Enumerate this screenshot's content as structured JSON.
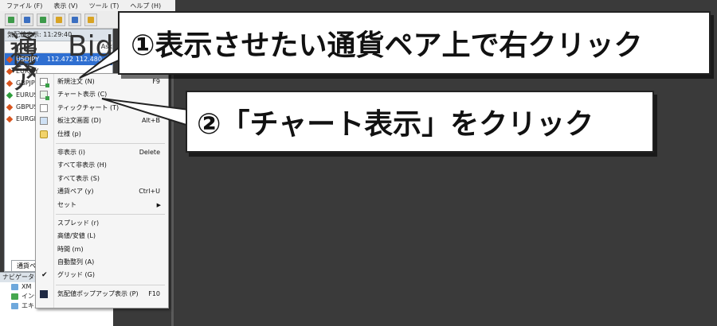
{
  "menubar": {
    "items": [
      "ファイル (F)",
      "表示 (V)",
      "ツール (T)",
      "ヘルプ (H)"
    ]
  },
  "market_watch": {
    "title": "気配値表示: 11:29:40",
    "columns": [
      "通貨ペア",
      "Bid",
      "Ask"
    ],
    "rows": [
      {
        "symbol": "USDJPY",
        "bid": "112.472",
        "ask": "112.480",
        "color": "red"
      },
      {
        "symbol": "EURJPY",
        "bid": "",
        "ask": "",
        "color": "red"
      },
      {
        "symbol": "GBPJPY",
        "bid": "",
        "ask": "",
        "color": "red"
      },
      {
        "symbol": "EURUSD",
        "bid": "",
        "ask": "",
        "color": "green"
      },
      {
        "symbol": "GBPUSD",
        "bid": "",
        "ask": "",
        "color": "red"
      },
      {
        "symbol": "EURGBP",
        "bid": "",
        "ask": "",
        "color": "red"
      }
    ],
    "tab": "通貨ペア"
  },
  "navigator": {
    "title": "ナビゲーター",
    "items": [
      "XM",
      "インディケータ",
      "エキスパートアドバイザ"
    ]
  },
  "context_menu": {
    "items": [
      {
        "label": "新規注文 (N)",
        "shortcut": "F9"
      },
      {
        "label": "チャート表示 (C)",
        "shortcut": ""
      },
      {
        "label": "ティックチャート (T)",
        "shortcut": ""
      },
      {
        "label": "板注文画面 (D)",
        "shortcut": "Alt+B"
      },
      {
        "label": "仕様 (p)",
        "shortcut": ""
      },
      {
        "label": "非表示 (i)",
        "shortcut": "Delete"
      },
      {
        "label": "すべて非表示 (H)",
        "shortcut": ""
      },
      {
        "label": "すべて表示 (S)",
        "shortcut": ""
      },
      {
        "label": "通貨ペア (y)",
        "shortcut": "Ctrl+U"
      },
      {
        "label": "セット",
        "shortcut": ""
      },
      {
        "label": "スプレッド (r)",
        "shortcut": ""
      },
      {
        "label": "高値/安値 (L)",
        "shortcut": ""
      },
      {
        "label": "時間 (m)",
        "shortcut": ""
      },
      {
        "label": "自動整列 (A)",
        "shortcut": ""
      },
      {
        "label": "グリッド (G)",
        "shortcut": ""
      },
      {
        "label": "気配値ポップアップ表示 (P)",
        "shortcut": "F10"
      }
    ]
  },
  "callouts": {
    "step1": "①表示させたい通貨ペア上で右クリック",
    "step2": "②「チャート表示」をクリック"
  },
  "colors": {
    "selected_row": "#2f6fd1",
    "background": "#3a3a3a"
  }
}
